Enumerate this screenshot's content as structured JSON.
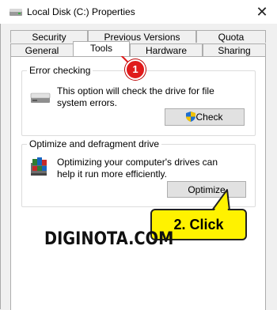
{
  "window": {
    "title": "Local Disk (C:) Properties",
    "close_glyph": "✕"
  },
  "tabs": {
    "row1": [
      "Security",
      "Previous Versions",
      "Quota"
    ],
    "row2": [
      "General",
      "Tools",
      "Hardware",
      "Sharing"
    ],
    "active": "Tools"
  },
  "error_checking": {
    "label": "Error checking",
    "description": "This option will check the drive for file system errors.",
    "button_label": "Check",
    "icon": "drive-icon",
    "button_icon": "uac-shield-icon"
  },
  "optimize": {
    "label": "Optimize and defragment drive",
    "description": "Optimizing your computer's drives can help it run more efficiently.",
    "button_label": "Optimize",
    "icon": "defrag-icon"
  },
  "annotations": {
    "step1_number": "1",
    "step2_text": "2. Click",
    "watermark": "DIGINOTA.COM",
    "step1_color": "#e01b1b",
    "step2_color": "#fff200"
  }
}
